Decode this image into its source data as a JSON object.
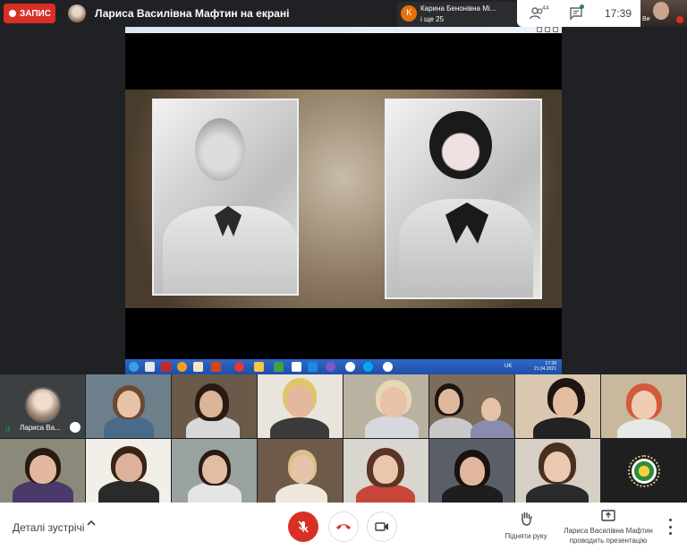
{
  "topbar": {
    "record_label": "ЗАПИС",
    "presenter_title": "Лариса Василівна Мафтин на екрані",
    "notice": {
      "initial": "К",
      "line1": "Карина Бенонівна Мі...",
      "line2": "і ще 25"
    },
    "participants_count": "44",
    "time": "17:39",
    "self_label": "Ви"
  },
  "presentation": {
    "taskbar": {
      "lang": "UK",
      "tray_time": "17:39",
      "tray_date": "21.04.2021"
    }
  },
  "tiles": [
    {
      "label": "Лариса Ва...",
      "active": true
    },
    {
      "bg": "#6e7f8c"
    },
    {
      "bg": "#6a5a4a"
    },
    {
      "bg": "#e9e4dc"
    },
    {
      "bg": "#b9b2a0"
    },
    {
      "bg": "#7c6c58"
    },
    {
      "bg": "#d9c7b0"
    },
    {
      "bg": "#c8b89c"
    },
    {
      "bg": "#8b8a7a"
    },
    {
      "bg": "#f2efe8"
    },
    {
      "bg": "#9aa2a0"
    },
    {
      "bg": "#6d5a48"
    },
    {
      "bg": "#d9d5cf"
    },
    {
      "bg": "#5b6068"
    },
    {
      "bg": "#d7cfc4"
    },
    {
      "logo": true
    }
  ],
  "bottombar": {
    "details_label": "Деталі зустрічі",
    "raise_label": "Підняти руку",
    "presenting_line1": "Лариса Василівна Мафтин",
    "presenting_line2": "проводить презентацію"
  },
  "colors": {
    "record": "#d93025",
    "mic_off": "#d93025",
    "bg": "#202124"
  }
}
